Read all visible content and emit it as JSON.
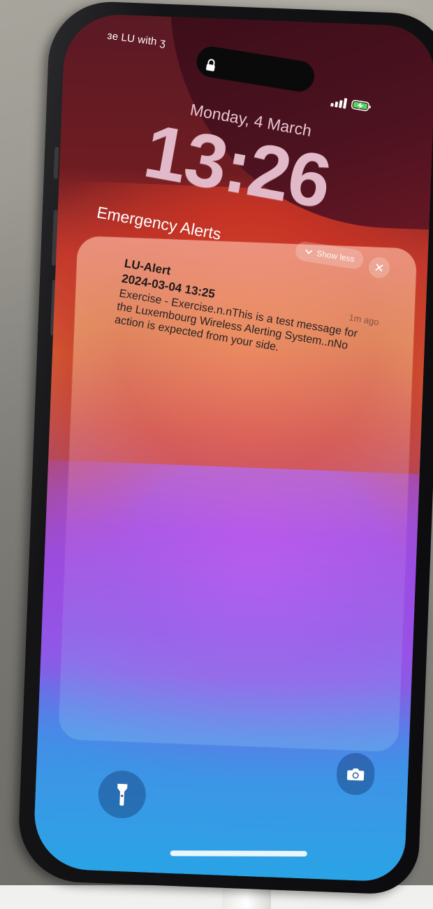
{
  "status_bar": {
    "carrier_text": "ɜe LU with ʒ"
  },
  "lock_screen": {
    "date": "Monday, 4 March",
    "time": "13:26"
  },
  "alerts": {
    "heading": "Emergency Alerts",
    "show_less_label": "Show less",
    "card": {
      "sender": "LU-Alert",
      "timestamp": "2024-03-04 13:25",
      "age": "1m ago",
      "body": "Exercise - Exercise.n.nThis is a test message for the Luxembourg Wireless Alerting System..nNo action is expected from your side."
    }
  },
  "icons": {
    "lock": "lock-icon",
    "signal": "cellular-signal-icon",
    "battery": "battery-charging-icon",
    "chevron": "chevron-down-icon",
    "close": "close-icon",
    "flashlight": "flashlight-icon",
    "camera": "camera-icon"
  },
  "colors": {
    "battery_green": "#4cd964",
    "alert_text": "#1e1a1a"
  }
}
